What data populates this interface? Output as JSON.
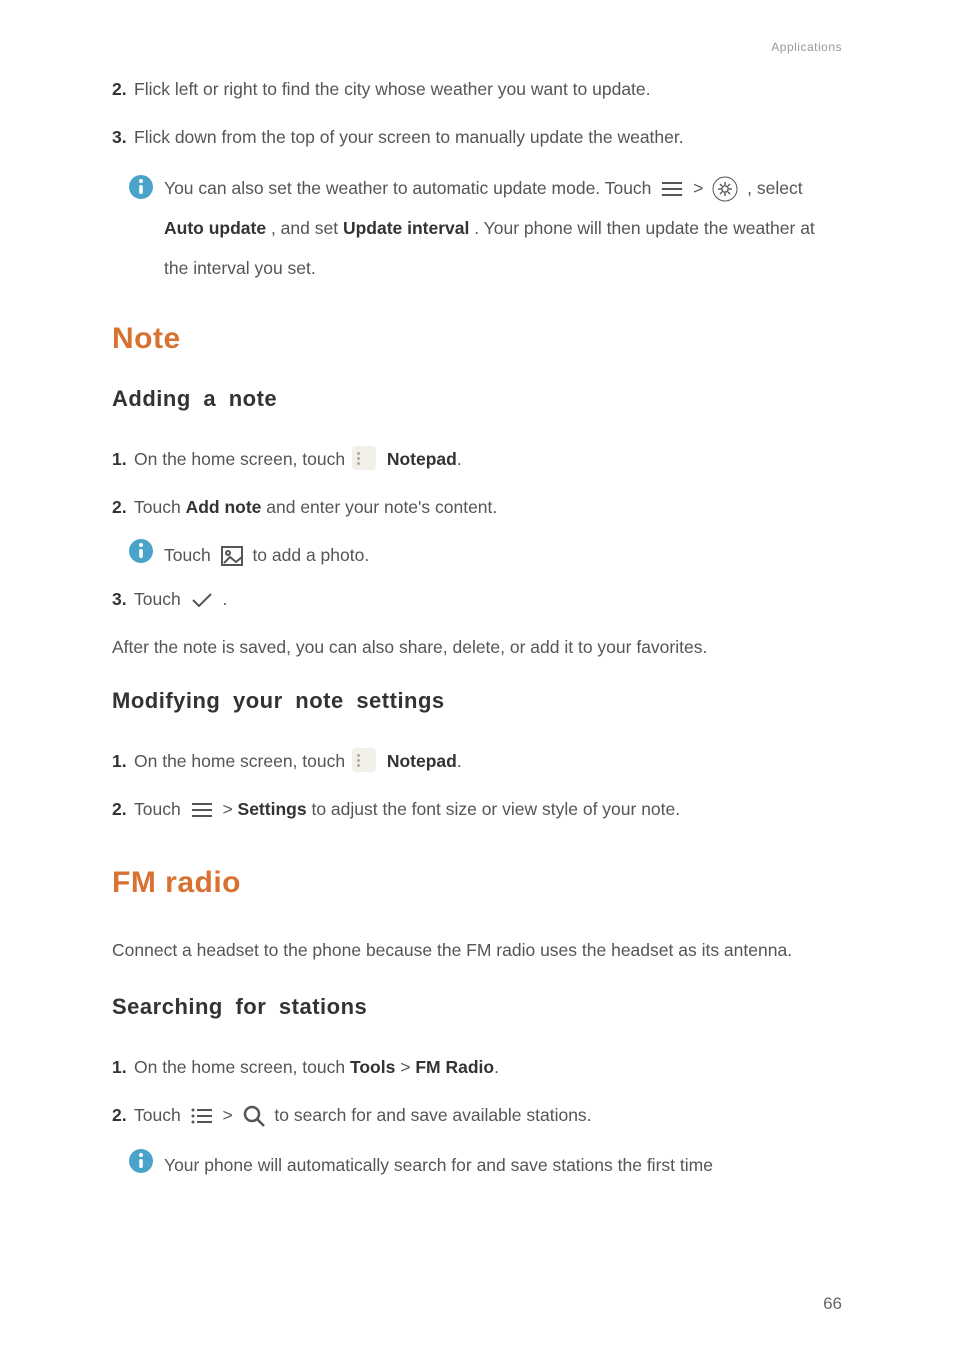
{
  "header": {
    "section_label": "Applications"
  },
  "intro": {
    "step2_num": "2.",
    "step2_body": "Flick left or right to find the city whose weather you want to update.",
    "step3_num": "3.",
    "step3_body": "Flick down from the top of your screen to manually update the weather.",
    "info_pre": "You can also set the weather to automatic update mode. Touch ",
    "info_gt": " > ",
    "info_select": ", select ",
    "info_auto": "Auto update",
    "info_andset": ", and set ",
    "info_interval": "Update interval",
    "info_tail": ". Your phone will then update the weather at the interval you set."
  },
  "note": {
    "heading": "Note",
    "adding": "Adding a note",
    "s1_num": "1.",
    "s1_pre": "On the home screen, touch ",
    "s1_bold": "Notepad",
    "s1_tail": ".",
    "s2_num": "2.",
    "s2_pre": "Touch ",
    "s2_bold": "Add note",
    "s2_tail": " and enter your note's content.",
    "info_pre": "Touch ",
    "info_tail": " to add a photo.",
    "s3_num": "3.",
    "s3_pre": "Touch ",
    "s3_tail": ".",
    "after": "After the note is saved, you can also share, delete, or add it to your favorites.",
    "modifying": "Modifying your note settings",
    "m1_num": "1.",
    "m1_pre": "On the home screen, touch ",
    "m1_bold": "Notepad",
    "m1_tail": ".",
    "m2_num": "2.",
    "m2_pre": "Touch ",
    "m2_mid": " > ",
    "m2_bold": "Settings",
    "m2_tail": " to adjust the font size or view style of your note."
  },
  "fm": {
    "heading": "FM radio",
    "intro": "Connect a headset to the phone because the FM radio uses the headset as its antenna.",
    "searching": "Searching for stations",
    "s1_num": "1.",
    "s1_pre": "On the home screen, touch ",
    "s1_b1": "Tools",
    "s1_gt": " > ",
    "s1_b2": "FM Radio",
    "s1_tail": ".",
    "s2_num": "2.",
    "s2_pre": "Touch ",
    "s2_gt": " > ",
    "s2_tail": " to search for and save available stations.",
    "info": "Your phone will automatically search for and save stations the first time"
  },
  "page_number": "66"
}
